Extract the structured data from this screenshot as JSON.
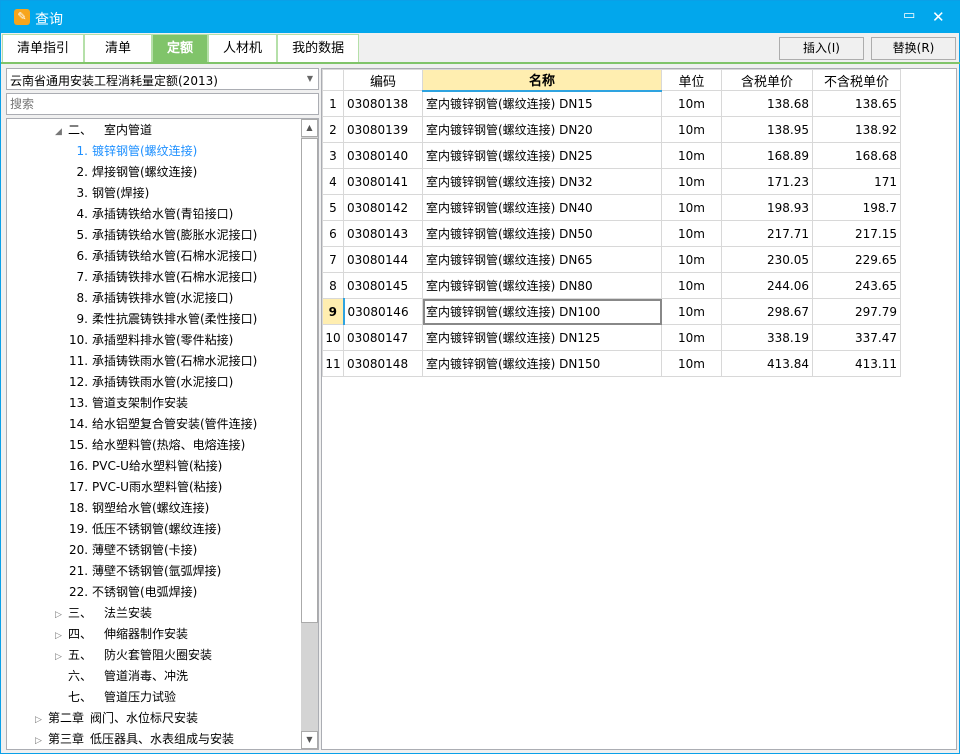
{
  "window": {
    "title": "查询",
    "maximize_icon": "maximize-icon",
    "close_icon": "close-icon",
    "logo": "app-logo"
  },
  "tabs": [
    {
      "label": "清单指引"
    },
    {
      "label": "清单"
    },
    {
      "label": "定额",
      "active": true
    },
    {
      "label": "人材机"
    },
    {
      "label": "我的数据"
    }
  ],
  "toolbar": {
    "insert_label": "插入(I)",
    "replace_label": "替换(R)"
  },
  "library": {
    "selected": "云南省通用安装工程消耗量定额(2013)"
  },
  "search": {
    "placeholder": "搜索",
    "value": ""
  },
  "tree": [
    {
      "level": 1,
      "expander": "expanded",
      "prefix": "二、",
      "label": "室内管道"
    },
    {
      "level": 2,
      "num": "1.",
      "label": "镀锌钢管(螺纹连接)",
      "selected": true
    },
    {
      "level": 2,
      "num": "2.",
      "label": "焊接钢管(螺纹连接)"
    },
    {
      "level": 2,
      "num": "3.",
      "label": "钢管(焊接)"
    },
    {
      "level": 2,
      "num": "4.",
      "label": "承插铸铁给水管(青铅接口)"
    },
    {
      "level": 2,
      "num": "5.",
      "label": "承插铸铁给水管(膨胀水泥接口)"
    },
    {
      "level": 2,
      "num": "6.",
      "label": "承插铸铁给水管(石棉水泥接口)"
    },
    {
      "level": 2,
      "num": "7.",
      "label": "承插铸铁排水管(石棉水泥接口)"
    },
    {
      "level": 2,
      "num": "8.",
      "label": "承插铸铁排水管(水泥接口)"
    },
    {
      "level": 2,
      "num": "9.",
      "label": "柔性抗震铸铁排水管(柔性接口)"
    },
    {
      "level": 2,
      "num": "10.",
      "label": "承插塑料排水管(零件粘接)"
    },
    {
      "level": 2,
      "num": "11.",
      "label": "承插铸铁雨水管(石棉水泥接口)"
    },
    {
      "level": 2,
      "num": "12.",
      "label": "承插铸铁雨水管(水泥接口)"
    },
    {
      "level": 2,
      "num": "13.",
      "label": "管道支架制作安装"
    },
    {
      "level": 2,
      "num": "14.",
      "label": "给水铝塑复合管安装(管件连接)"
    },
    {
      "level": 2,
      "num": "15.",
      "label": "给水塑料管(热熔、电熔连接)"
    },
    {
      "level": 2,
      "num": "16.",
      "label": "PVC-U给水塑料管(粘接)"
    },
    {
      "level": 2,
      "num": "17.",
      "label": "PVC-U雨水塑料管(粘接)"
    },
    {
      "level": 2,
      "num": "18.",
      "label": "钢塑给水管(螺纹连接)"
    },
    {
      "level": 2,
      "num": "19.",
      "label": "低压不锈钢管(螺纹连接)"
    },
    {
      "level": 2,
      "num": "20.",
      "label": "薄壁不锈钢管(卡接)"
    },
    {
      "level": 2,
      "num": "21.",
      "label": "薄壁不锈钢管(氩弧焊接)"
    },
    {
      "level": 2,
      "num": "22.",
      "label": "不锈钢管(电弧焊接)"
    },
    {
      "level": 1,
      "expander": "collapsed",
      "prefix": "三、",
      "label": "法兰安装"
    },
    {
      "level": 1,
      "expander": "collapsed",
      "prefix": "四、",
      "label": "伸缩器制作安装"
    },
    {
      "level": 1,
      "expander": "collapsed",
      "prefix": "五、",
      "label": "防火套管阻火圈安装"
    },
    {
      "level": 1,
      "expander": "none",
      "prefix": "六、",
      "label": "管道消毒、冲洗"
    },
    {
      "level": 1,
      "expander": "none",
      "prefix": "七、",
      "label": "管道压力试验"
    },
    {
      "level": 0,
      "expander": "collapsed",
      "prefix": "第二章",
      "label": "阀门、水位标尺安装"
    },
    {
      "level": 0,
      "expander": "collapsed",
      "prefix": "第三章",
      "label": "低压器具、水表组成与安装"
    }
  ],
  "grid": {
    "columns": [
      "",
      "编码",
      "名称",
      "单位",
      "含税单价",
      "不含税单价"
    ],
    "current_row": 9,
    "rows": [
      [
        "1",
        "03080138",
        "室内镀锌钢管(螺纹连接) DN15",
        "10m",
        "138.68",
        "138.65"
      ],
      [
        "2",
        "03080139",
        "室内镀锌钢管(螺纹连接) DN20",
        "10m",
        "138.95",
        "138.92"
      ],
      [
        "3",
        "03080140",
        "室内镀锌钢管(螺纹连接) DN25",
        "10m",
        "168.89",
        "168.68"
      ],
      [
        "4",
        "03080141",
        "室内镀锌钢管(螺纹连接) DN32",
        "10m",
        "171.23",
        "171"
      ],
      [
        "5",
        "03080142",
        "室内镀锌钢管(螺纹连接) DN40",
        "10m",
        "198.93",
        "198.7"
      ],
      [
        "6",
        "03080143",
        "室内镀锌钢管(螺纹连接) DN50",
        "10m",
        "217.71",
        "217.15"
      ],
      [
        "7",
        "03080144",
        "室内镀锌钢管(螺纹连接) DN65",
        "10m",
        "230.05",
        "229.65"
      ],
      [
        "8",
        "03080145",
        "室内镀锌钢管(螺纹连接) DN80",
        "10m",
        "244.06",
        "243.65"
      ],
      [
        "9",
        "03080146",
        "室内镀锌钢管(螺纹连接) DN100",
        "10m",
        "298.67",
        "297.79"
      ],
      [
        "10",
        "03080147",
        "室内镀锌钢管(螺纹连接) DN125",
        "10m",
        "338.19",
        "337.47"
      ],
      [
        "11",
        "03080148",
        "室内镀锌钢管(螺纹连接) DN150",
        "10m",
        "413.84",
        "413.11"
      ]
    ]
  },
  "colors": {
    "titlebar": "#02a7ec",
    "tab_active": "#80c46a",
    "header_highlight": "#ffeeb0",
    "selected_tree": "#1e90ff"
  }
}
